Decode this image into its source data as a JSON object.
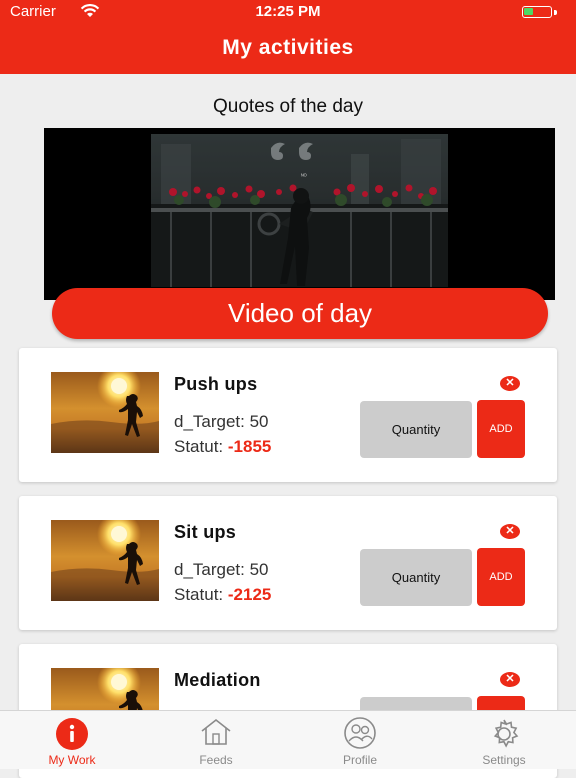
{
  "status_bar": {
    "carrier": "Carrier",
    "time": "12:25 PM",
    "battery_color": "#4cd964"
  },
  "header": {
    "title": "My activities"
  },
  "quotes": {
    "title": "Quotes of the day"
  },
  "video": {
    "button_label": "Video of day"
  },
  "activities": [
    {
      "name": "Push ups",
      "target": "d_Target: 50",
      "statut_label": "Statut:",
      "statut_value": "-1855",
      "quantity_placeholder": "Quantity",
      "add_label": "ADD"
    },
    {
      "name": "Sit ups",
      "target": "d_Target: 50",
      "statut_label": "Statut:",
      "statut_value": "-2125",
      "quantity_placeholder": "Quantity",
      "add_label": "ADD"
    },
    {
      "name": "Mediation"
    }
  ],
  "tabs": [
    {
      "label": "My Work",
      "icon": "info-icon",
      "active": true
    },
    {
      "label": "Feeds",
      "icon": "home-icon"
    },
    {
      "label": "Profile",
      "icon": "profile-icon"
    },
    {
      "label": "Settings",
      "icon": "gear-icon"
    }
  ],
  "colors": {
    "accent": "#ec2a17",
    "background": "#eeeeee",
    "quantity_bg": "#cccccc"
  }
}
